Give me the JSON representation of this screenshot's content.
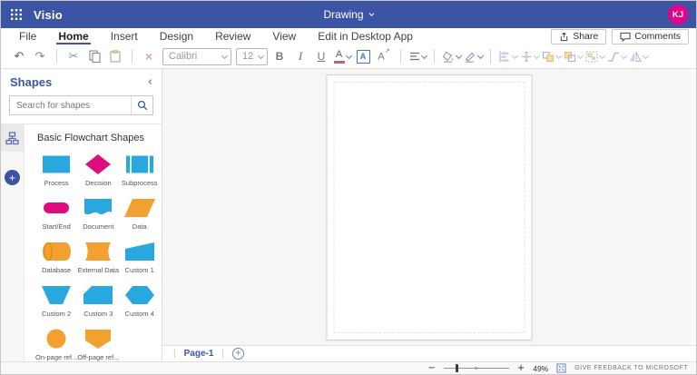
{
  "topbar": {
    "app_name": "Visio",
    "document_title": "Drawing",
    "avatar_initials": "KJ"
  },
  "menubar": {
    "items": [
      {
        "label": "File"
      },
      {
        "label": "Home",
        "active": true
      },
      {
        "label": "Insert"
      },
      {
        "label": "Design"
      },
      {
        "label": "Review"
      },
      {
        "label": "View"
      },
      {
        "label": "Edit in Desktop App"
      }
    ],
    "share_label": "Share",
    "comments_label": "Comments"
  },
  "ribbon": {
    "font_name": "Calibri",
    "font_size": "12",
    "bold_label": "B",
    "italic_label": "I",
    "underline_label": "U",
    "font_color_label": "A",
    "text_box_label": "A",
    "edit_text_label": "A"
  },
  "shapes_panel": {
    "title": "Shapes",
    "collapse_glyph": "‹",
    "search_placeholder": "Search for shapes",
    "stencil_title": "Basic Flowchart Shapes",
    "add_stencil_glyph": "+",
    "shapes": [
      {
        "name": "Process",
        "color": "#29A8E0"
      },
      {
        "name": "Decision",
        "color": "#DE0D7F"
      },
      {
        "name": "Subprocess",
        "color": "#29A8E0"
      },
      {
        "name": "Start/End",
        "color": "#DE0D7F"
      },
      {
        "name": "Document",
        "color": "#29A8E0"
      },
      {
        "name": "Data",
        "color": "#F2A130"
      },
      {
        "name": "Database",
        "color": "#F2A130"
      },
      {
        "name": "External Data",
        "color": "#F2A130"
      },
      {
        "name": "Custom 1",
        "color": "#29A8E0"
      },
      {
        "name": "Custom 2",
        "color": "#29A8E0"
      },
      {
        "name": "Custom 3",
        "color": "#29A8E0"
      },
      {
        "name": "Custom 4",
        "color": "#29A8E0"
      },
      {
        "name": "On-page ref...",
        "color": "#F2A130"
      },
      {
        "name": "Off-page ref...",
        "color": "#F2A130"
      }
    ]
  },
  "pagetabs": {
    "page_name": "Page-1",
    "add_page_glyph": "+"
  },
  "statusbar": {
    "zoom_out_glyph": "−",
    "zoom_in_glyph": "+",
    "zoom_level": "49%",
    "feedback_label": "GIVE FEEDBACK TO MICROSOFT"
  },
  "colors": {
    "brand_blue": "#3B55A4",
    "avatar_pink": "#E3008C",
    "shape_blue": "#29A8E0",
    "shape_magenta": "#DE0D7F",
    "shape_orange": "#F2A130",
    "canvas_bg": "#F7F6F5"
  }
}
